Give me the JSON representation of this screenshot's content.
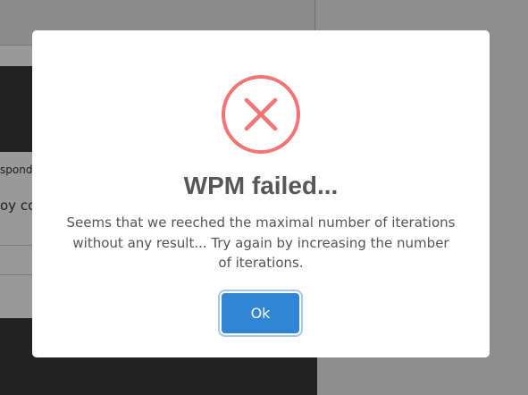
{
  "background": {
    "respond_fragment": "spond",
    "by_fragment": "oy cor"
  },
  "dialog": {
    "icon": "error-x-icon",
    "icon_color": "#f27474",
    "title": "WPM failed...",
    "message": "Seems that we reeched the maximal number of iterations without any result... Try again by increasing the number of iterations.",
    "confirm_label": "Ok",
    "confirm_color": "#3085d6"
  }
}
